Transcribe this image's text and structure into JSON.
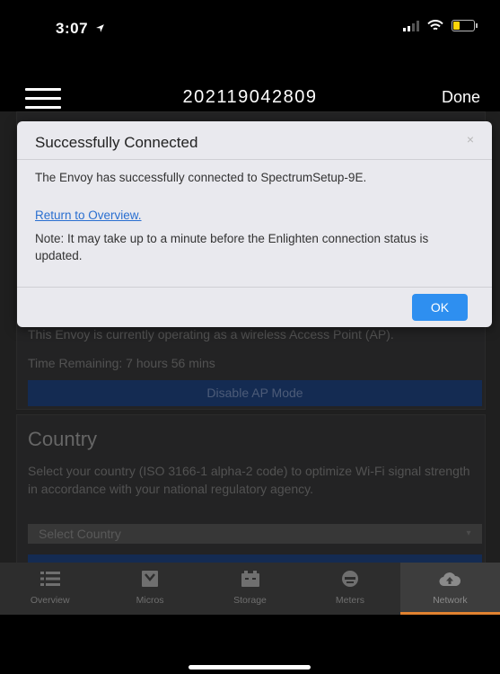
{
  "status": {
    "time": "3:07"
  },
  "nav": {
    "title": "202119042809",
    "done_label": "Done"
  },
  "ap_card": {
    "text": "This Envoy is currently operating as a wireless Access Point (AP).",
    "time_remaining": "Time Remaining: 7 hours 56 mins",
    "disable_button": "Disable AP Mode"
  },
  "country_card": {
    "title": "Country",
    "description": "Select your country (ISO 3166-1 alpha-2 code) to optimize Wi-Fi signal strength in accordance with your national regulatory agency.",
    "select_value": "Select Country"
  },
  "modal": {
    "title": "Successfully Connected",
    "close": "×",
    "message": "The Envoy has successfully connected to SpectrumSetup-9E.",
    "link": "Return to Overview.",
    "note": "Note: It may take up to a minute before the Enlighten connection status is updated.",
    "ok_label": "OK"
  },
  "tabs": [
    {
      "label": "Overview",
      "icon": "list-icon"
    },
    {
      "label": "Micros",
      "icon": "microinverter-icon"
    },
    {
      "label": "Storage",
      "icon": "battery-storage-icon"
    },
    {
      "label": "Meters",
      "icon": "meter-icon"
    },
    {
      "label": "Network",
      "icon": "cloud-upload-icon",
      "active": true
    }
  ],
  "colors": {
    "accent": "#2e8ff0",
    "tab_active_indicator": "#e08230",
    "link": "#2a6fd0"
  }
}
